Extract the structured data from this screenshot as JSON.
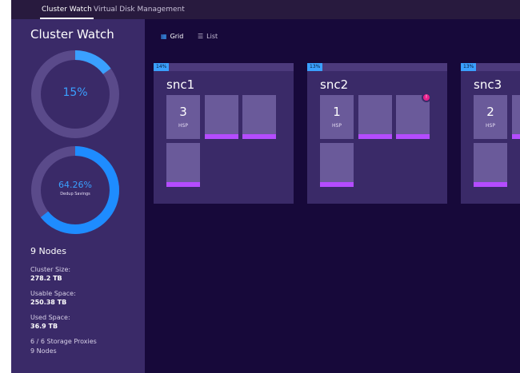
{
  "tabs": [
    {
      "label": "Cluster Watch",
      "active": true
    },
    {
      "label": "Virtual Disk Management",
      "active": false
    }
  ],
  "sidebar": {
    "title": "Cluster Watch",
    "usage_ring": {
      "value_label": "15%",
      "fraction": 0.15,
      "color": "#3aa0ff",
      "track_color": "#5a4a8a"
    },
    "dedup_ring": {
      "value_label": "64.26%",
      "caption": "Dedup Savings",
      "fraction": 0.6426,
      "color": "#1e8cff",
      "track_color": "#5a4a8a"
    },
    "nodes_title": "9 Nodes",
    "stats": [
      {
        "label": "Cluster Size:",
        "value": "278.2 TB"
      },
      {
        "label": "Usable Space:",
        "value": "250.38 TB"
      },
      {
        "label": "Used Space:",
        "value": "36.9 TB"
      }
    ],
    "footer_lines": [
      "6 / 6 Storage Proxies",
      "9 Nodes"
    ]
  },
  "view_toggle": {
    "grid_label": "Grid",
    "list_label": "List",
    "grid_icon": "grid-icon",
    "list_icon": "list-icon",
    "active": "grid"
  },
  "nodes": [
    {
      "name": "snc1",
      "percent": "14%",
      "hsp_count": "3",
      "hsp_label": "HSP",
      "alert": false
    },
    {
      "name": "snc2",
      "percent": "13%",
      "hsp_count": "1",
      "hsp_label": "HSP",
      "alert": true,
      "alert_text": "!"
    },
    {
      "name": "snc3",
      "percent": "13%",
      "hsp_count": "2",
      "hsp_label": "HSP",
      "alert": false
    }
  ],
  "colors": {
    "background": "#17093a",
    "panel": "#3a2a68",
    "accent_blue": "#3aa0ff",
    "accent_purple": "#b44cff",
    "alert_pink": "#e8208c"
  }
}
